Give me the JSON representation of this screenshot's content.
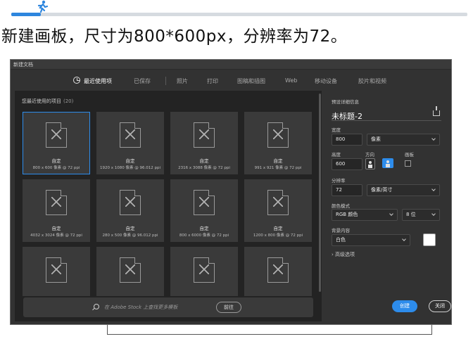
{
  "header": {
    "headline": "新建画板，尺寸为800*600px，分辨率为72。"
  },
  "dialog": {
    "title": "新建文档",
    "tabs": [
      {
        "label": "最近使用项",
        "active": true
      },
      {
        "label": "已保存"
      },
      {
        "label": "照片"
      },
      {
        "label": "打印"
      },
      {
        "label": "图稿和插图"
      },
      {
        "label": "Web"
      },
      {
        "label": "移动设备"
      },
      {
        "label": "胶片和视频"
      }
    ],
    "recent": {
      "title": "您最近使用的项目",
      "count": "(20)",
      "items": [
        {
          "name": "自定",
          "size": "800 x 600 像素 @ 72 ppi",
          "selected": true
        },
        {
          "name": "自定",
          "size": "1920 x 1080 像素 @ 96.012 ppi"
        },
        {
          "name": "自定",
          "size": "2316 x 3088 像素 @ 72 ppi"
        },
        {
          "name": "自定",
          "size": "991 x 921 像素 @ 72 ppi"
        },
        {
          "name": "自定",
          "size": "4032 x 3024 像素 @ 72 ppi"
        },
        {
          "name": "自定",
          "size": "280 x 500 像素 @ 96.012 ppi"
        },
        {
          "name": "自定",
          "size": "800 x 6000 像素 @ 72 ppi"
        },
        {
          "name": "自定",
          "size": "1200 x 800 像素 @ 72 ppi"
        }
      ]
    },
    "stock": {
      "placeholder": "在 Adobe Stock 上查找更多模板",
      "go_label": "前往"
    },
    "details": {
      "section_title": "预设详细信息",
      "doc_name": "未标题-2",
      "width_label": "宽度",
      "width_value": "800",
      "width_unit": "像素",
      "height_label": "高度",
      "height_value": "600",
      "orientation_label": "方向",
      "artboard_label": "画板",
      "resolution_label": "分辨率",
      "resolution_value": "72",
      "resolution_unit": "像素/英寸",
      "color_mode_label": "颜色模式",
      "color_mode_value": "RGB 颜色",
      "bit_depth": "8 位",
      "background_label": "背景内容",
      "background_value": "白色",
      "background_color": "#ffffff",
      "advanced_label": "高级选项",
      "create_label": "创建",
      "close_label": "关闭"
    },
    "accent_color": "#2d8ceb"
  }
}
